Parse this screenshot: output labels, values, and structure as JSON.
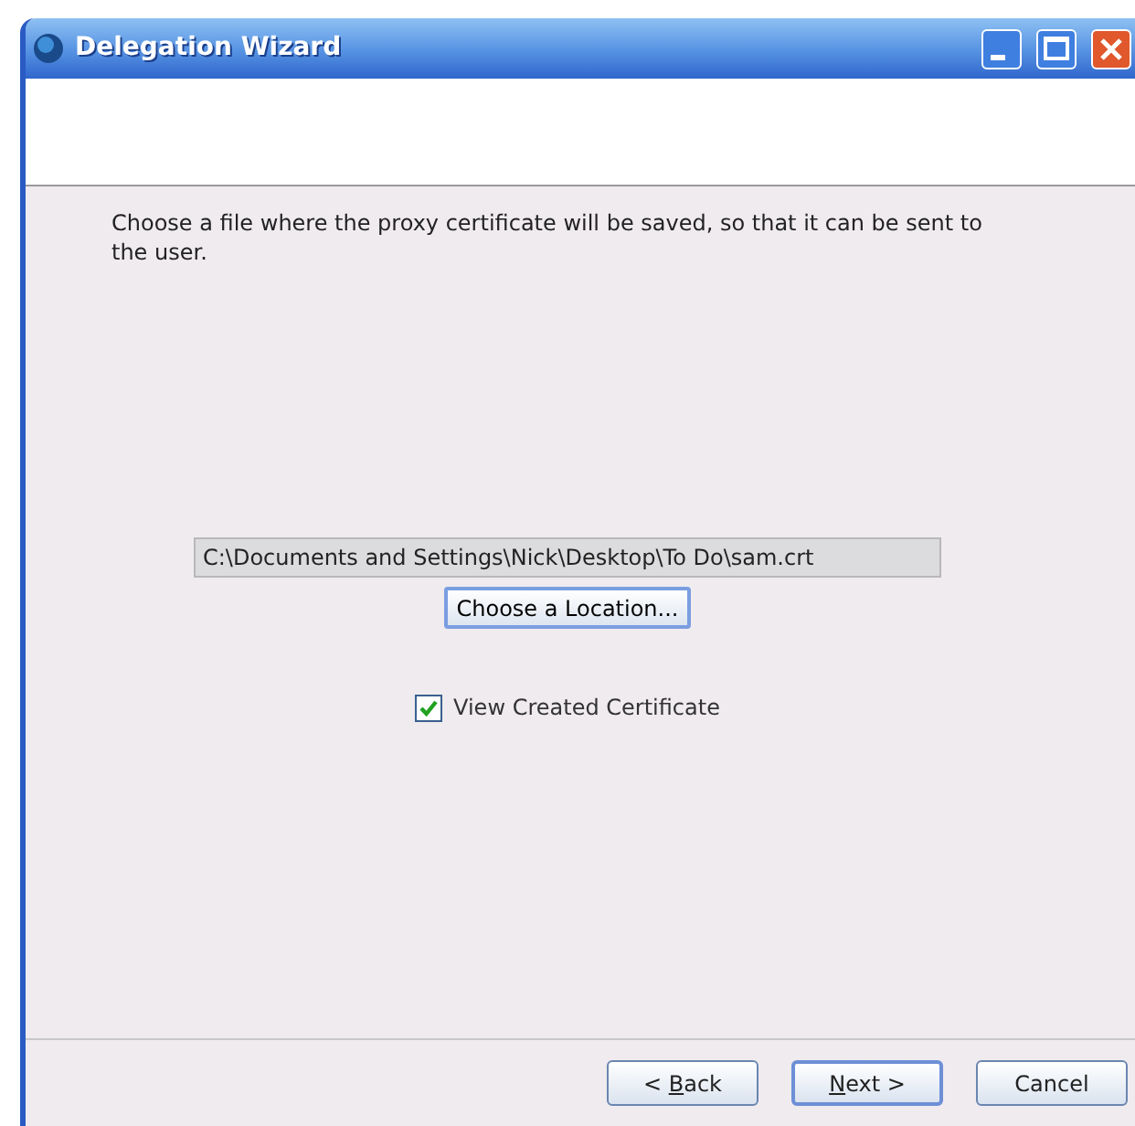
{
  "window": {
    "title": "Delegation Wizard"
  },
  "instruction": "Choose a file where the proxy certificate will be saved, so that it can be sent to the user.",
  "file_path": {
    "value": "C:\\Documents and Settings\\Nick\\Desktop\\To Do\\sam.crt",
    "disabled": true
  },
  "choose_button": {
    "label": "Choose a Location...",
    "focused": true
  },
  "view_checkbox": {
    "label": "View Created Certificate",
    "checked": true
  },
  "buttons": [
    {
      "before": "< ",
      "key": "B",
      "after": "ack",
      "default": false
    },
    {
      "key": "N",
      "after": "ext >",
      "default": true
    },
    {
      "before": "Cancel",
      "default": false
    }
  ]
}
